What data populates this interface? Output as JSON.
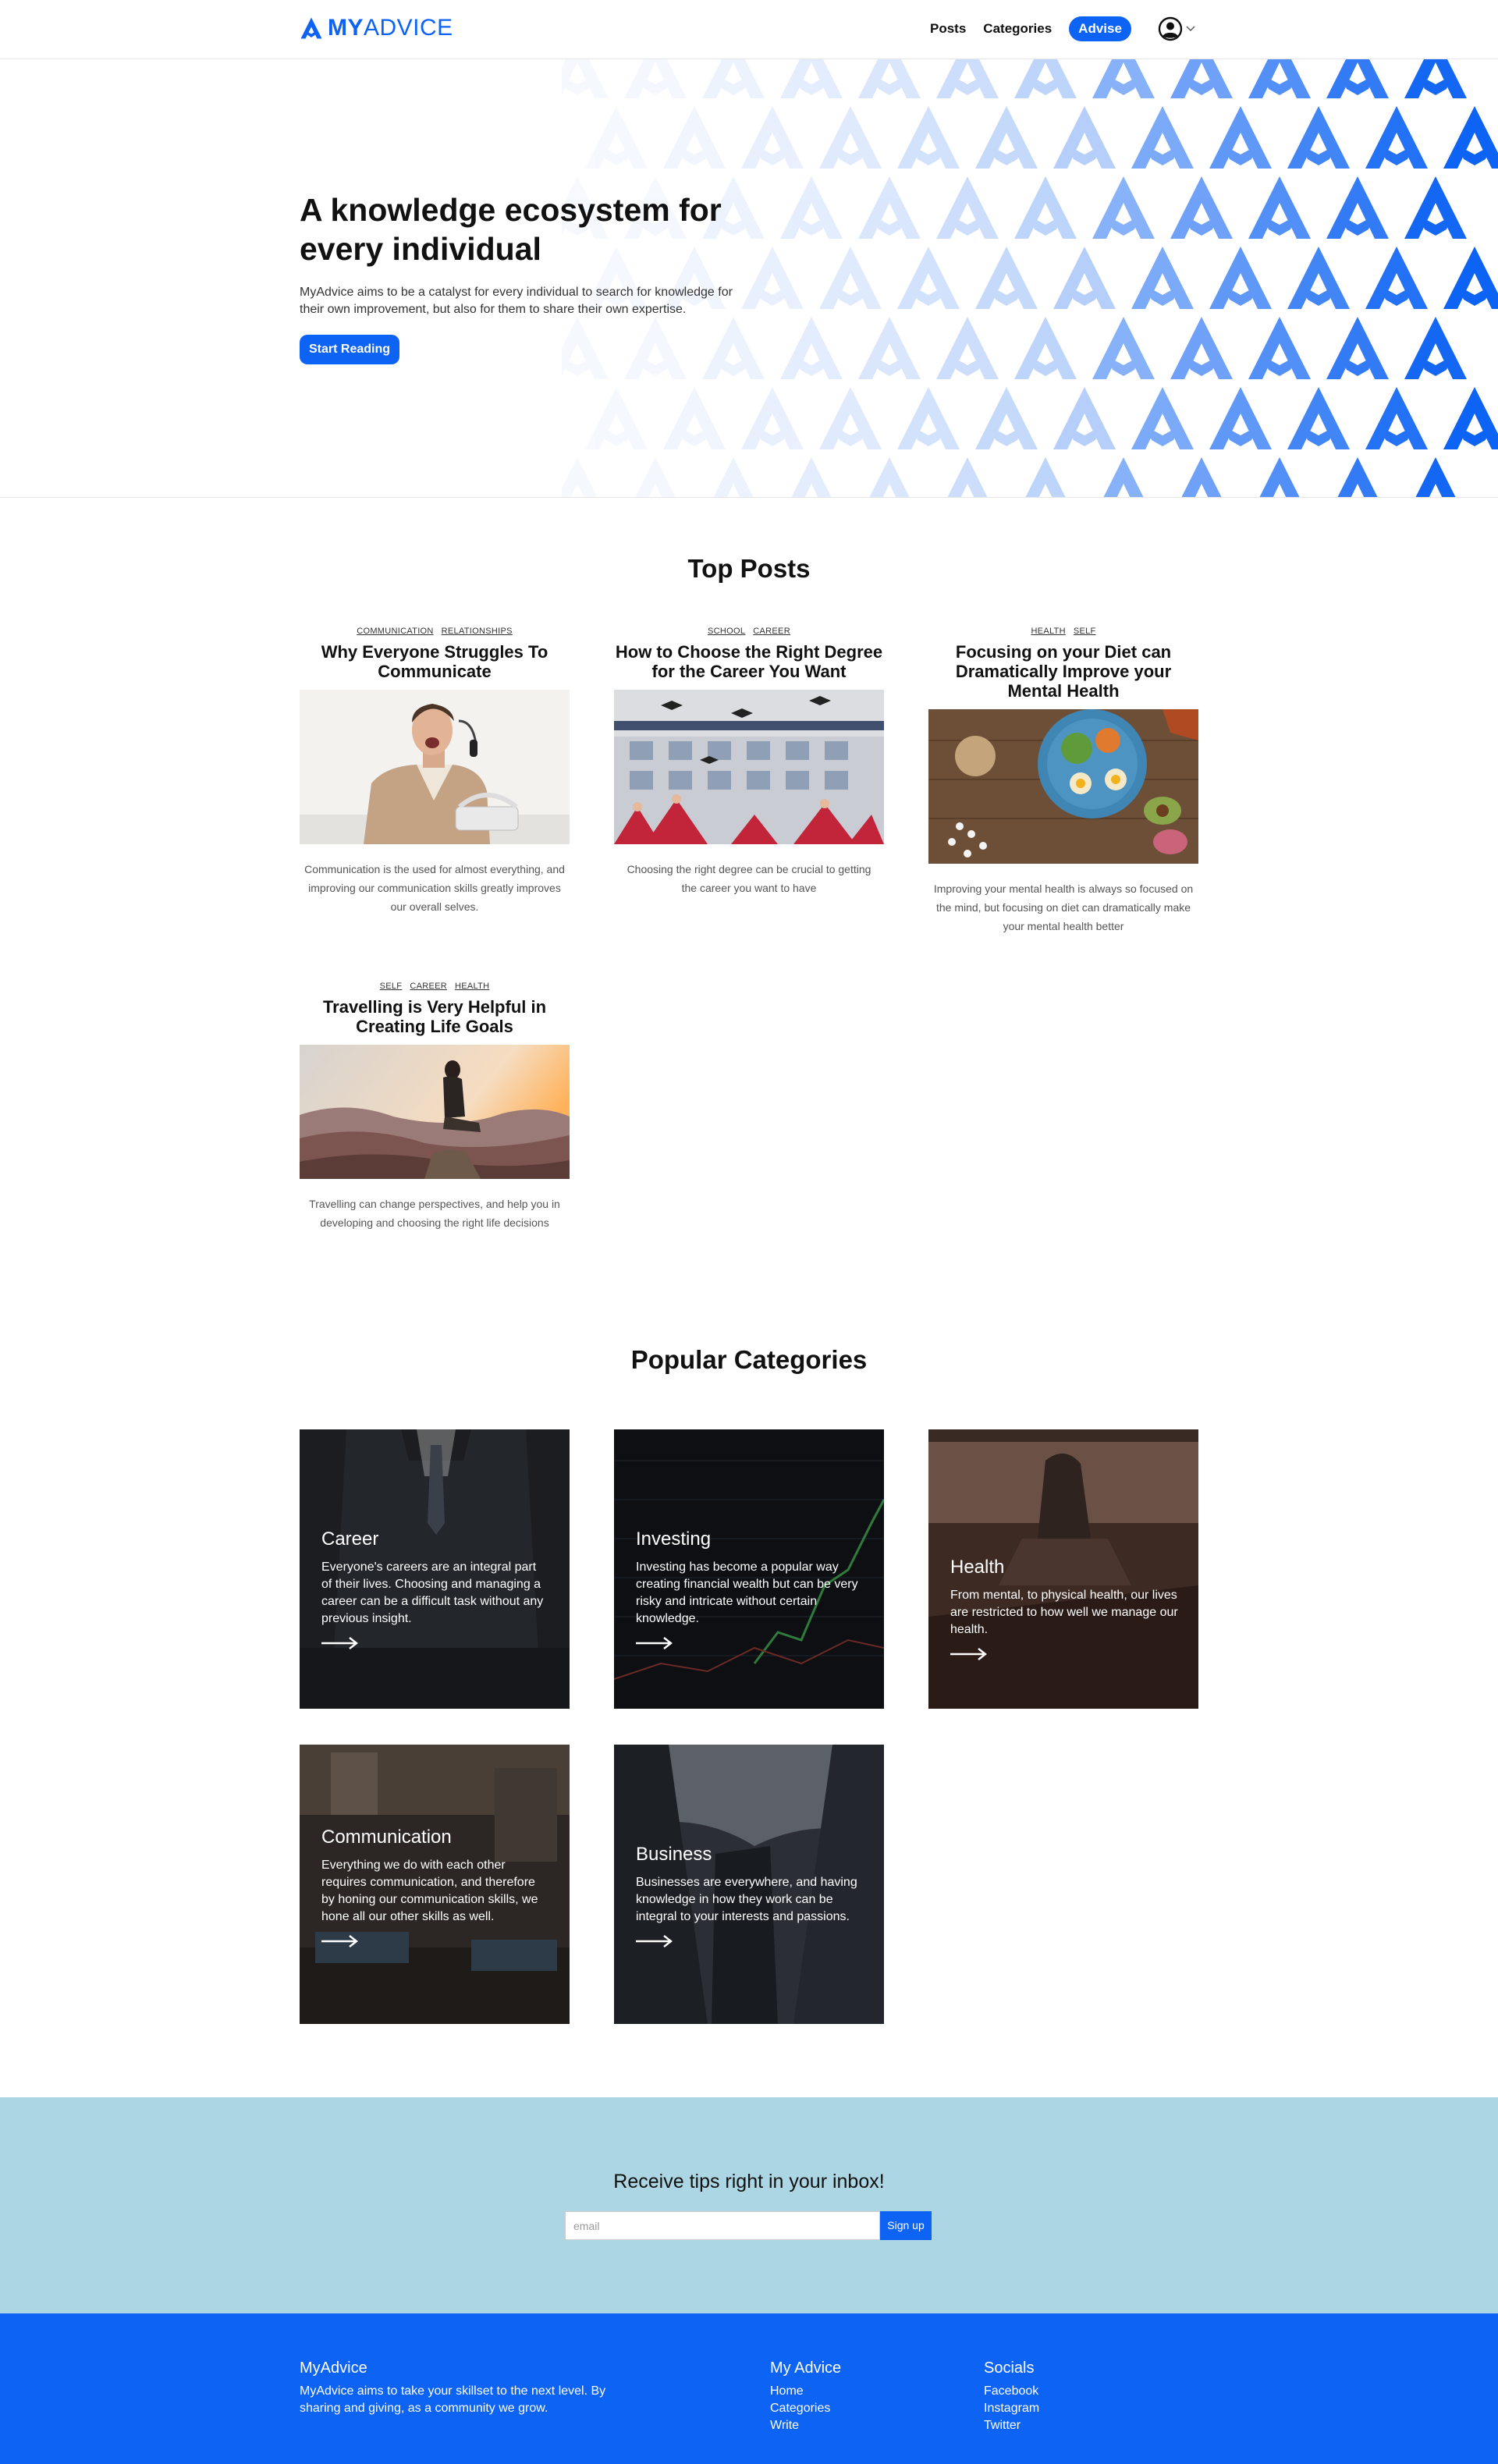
{
  "nav": {
    "logo": {
      "part1": "MY",
      "part2": "ADVICE"
    },
    "links": [
      "Posts",
      "Categories"
    ],
    "advise_label": "Advise",
    "user_icon": "user-circle-icon"
  },
  "hero": {
    "title": "A knowledge ecosystem for every individual",
    "subtitle": "MyAdvice aims to be a catalyst for every individual to search for knowledge for their own improvement, but also for them to share their own expertise.",
    "cta": "Start Reading"
  },
  "top_posts": {
    "heading": "Top Posts",
    "posts": [
      {
        "tags": [
          "COMMUNICATION",
          "RELATIONSHIPS"
        ],
        "title": "Why Everyone Struggles To Communicate",
        "description": "Communication is the used for almost everything, and improving our communication skills greatly improves our overall selves."
      },
      {
        "tags": [
          "SCHOOL",
          "CAREER"
        ],
        "title": "How to Choose the Right Degree for the Career You Want",
        "description": "Choosing the right degree can be crucial to getting the career you want to have"
      },
      {
        "tags": [
          "HEALTH",
          "SELF"
        ],
        "title": "Focusing on your Diet can Dramatically Improve your Mental Health",
        "description": "Improving your mental health is always so focused on the mind, but focusing on diet can dramatically make your mental health better"
      },
      {
        "tags": [
          "SELF",
          "CAREER",
          "HEALTH"
        ],
        "title": "Travelling is Very Helpful in Creating Life Goals",
        "description": "Travelling can change perspectives, and help you in developing and choosing the right life decisions"
      }
    ]
  },
  "popular_categories": {
    "heading": "Popular Categories",
    "items": [
      {
        "title": "Career",
        "description": "Everyone's careers are an integral part of their lives. Choosing and managing a career can be a difficult task without any previous insight."
      },
      {
        "title": "Investing",
        "description": "Investing has become a popular way creating financial wealth but can be very risky and intricate without certain knowledge."
      },
      {
        "title": "Health",
        "description": "From mental, to physical health, our lives are restricted to how well we manage our health."
      },
      {
        "title": "Communication",
        "description": "Everything we do with each other requires communication, and therefore by honing our communication skills, we hone all our other skills as well."
      },
      {
        "title": "Business",
        "description": "Businesses are everywhere, and having knowledge in how they work can be integral to your interests and passions."
      }
    ]
  },
  "newsletter": {
    "title": "Receive tips right in your inbox!",
    "placeholder": "email",
    "button": "Sign up"
  },
  "footer": {
    "brand": {
      "heading": "MyAdvice",
      "text": "MyAdvice aims to take your skillset to the next level. By sharing and giving, as a community we grow."
    },
    "my_advice": {
      "heading": "My Advice",
      "links": [
        "Home",
        "Categories",
        "Write"
      ]
    },
    "socials": {
      "heading": "Socials",
      "links": [
        "Facebook",
        "Instagram",
        "Twitter"
      ]
    }
  },
  "colors": {
    "brand_blue": "#0d63f3",
    "newsletter_bg": "#acd6e4",
    "footer_bg": "#0d63f3"
  }
}
